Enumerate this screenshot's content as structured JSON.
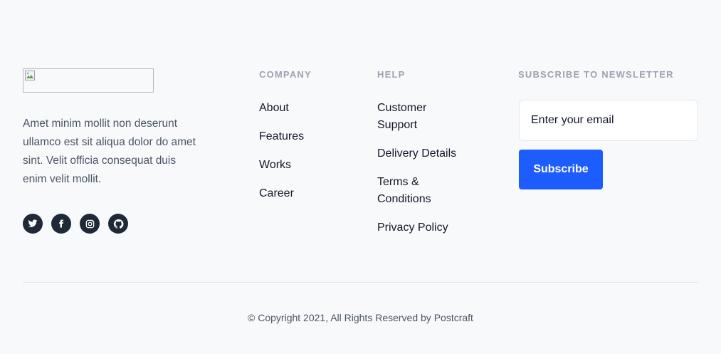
{
  "brand": {
    "logo_alt": "",
    "description": "Amet minim mollit non deserunt ullamco est sit aliqua dolor do amet sint. Velit officia consequat duis enim velit mollit."
  },
  "socials": [
    {
      "name": "twitter-icon"
    },
    {
      "name": "facebook-icon"
    },
    {
      "name": "instagram-icon"
    },
    {
      "name": "github-icon"
    }
  ],
  "company": {
    "title": "Company",
    "links": [
      "About",
      "Features",
      "Works",
      "Career"
    ]
  },
  "help": {
    "title": "Help",
    "links": [
      "Customer Support",
      "Delivery Details",
      "Terms & Conditions",
      "Privacy Policy"
    ]
  },
  "newsletter": {
    "title": "Subscribe to newsletter",
    "placeholder": "Enter your email",
    "button_label": "Subscribe"
  },
  "footer": {
    "copyright": "© Copyright 2021, All Rights Reserved by Postcraft"
  },
  "colors": {
    "accent": "#1d5cff",
    "background": "#f8f9fb",
    "social_bg": "#1f2937",
    "muted": "#9ca3af"
  }
}
